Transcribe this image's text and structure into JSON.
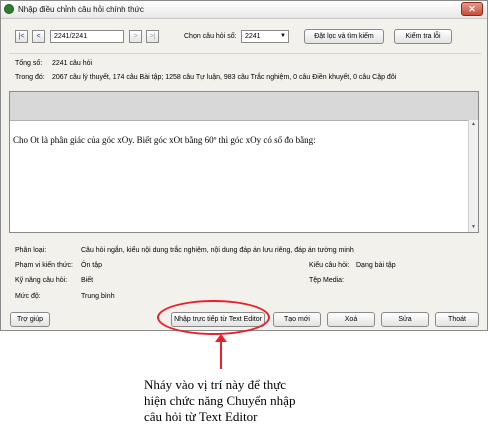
{
  "window": {
    "title": "Nhập điều chỉnh câu hỏi chính thức"
  },
  "nav": {
    "first": "|<",
    "prev": "<",
    "next": ">",
    "last": ">|",
    "record_value": "2241/2241"
  },
  "selector": {
    "label": "Chọn câu hỏi số:",
    "value": "2241"
  },
  "toolbar": {
    "filter_label": "Đặt lọc và tìm kiếm",
    "check_label": "Kiểm tra lỗi"
  },
  "summary": {
    "total_label": "Tổng số:",
    "total_value": "2241 câu hỏi",
    "within_label": "Trong đó:",
    "within_value": "2067 câu lý thuyết, 174 câu Bài tập; 1258 câu Tự luận, 983 câu Trắc nghiệm, 0 câu Điền khuyết, 0 câu Cặp đôi"
  },
  "editor": {
    "content": "Cho Ot là phân giác của góc xOy. Biết góc xOt  bằng 60º thì góc xOy có số đo bằng:"
  },
  "details": {
    "classify_label": "Phân loại:",
    "classify_value": "Câu hỏi ngắn, kiểu nội dung trắc nghiệm, nội dung đáp án lưu riêng, đáp án tường minh",
    "scope_label": "Phạm vi kiến thức:",
    "scope_value": "Ôn tập",
    "type_label": "Kiểu câu hỏi:",
    "type_value": "Dạng bài tập",
    "skill_label": "Kỹ năng câu hỏi:",
    "skill_value": "Biết",
    "media_label": "Tệp Media:",
    "level_label": "Mức độ:",
    "level_value": "Trung bình"
  },
  "footer": {
    "help": "Trợ giúp",
    "import_text_editor": "Nhập trực tiếp từ Text Editor",
    "new": "Tạo mới",
    "delete": "Xoá",
    "edit": "Sửa",
    "exit": "Thoát"
  },
  "annotation": {
    "line1": "Nháy vào vị trí này để thực",
    "line2": "hiện chức năng Chuyển nhập",
    "line3": "câu hỏi từ Text Editor",
    "color": "#e8202a"
  }
}
